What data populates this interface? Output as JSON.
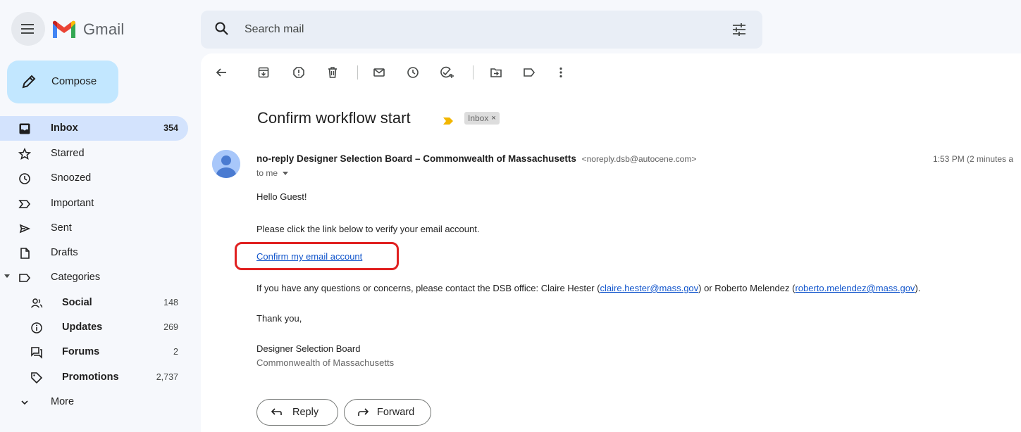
{
  "app": {
    "name": "Gmail"
  },
  "search": {
    "placeholder": "Search mail"
  },
  "compose": {
    "label": "Compose"
  },
  "sidebar": {
    "items": [
      {
        "label": "Inbox",
        "count": "354",
        "icon": "inbox-icon"
      },
      {
        "label": "Starred",
        "count": "",
        "icon": "star-icon"
      },
      {
        "label": "Snoozed",
        "count": "",
        "icon": "clock-icon"
      },
      {
        "label": "Important",
        "count": "",
        "icon": "important-icon"
      },
      {
        "label": "Sent",
        "count": "",
        "icon": "send-icon"
      },
      {
        "label": "Drafts",
        "count": "",
        "icon": "draft-icon"
      },
      {
        "label": "Categories",
        "count": "",
        "icon": "label-icon"
      },
      {
        "label": "Social",
        "count": "148",
        "icon": "people-icon"
      },
      {
        "label": "Updates",
        "count": "269",
        "icon": "info-icon"
      },
      {
        "label": "Forums",
        "count": "2",
        "icon": "forum-icon"
      },
      {
        "label": "Promotions",
        "count": "2,737",
        "icon": "tag-icon"
      },
      {
        "label": "More",
        "count": "",
        "icon": "chevron-down-icon"
      }
    ]
  },
  "email": {
    "subject": "Confirm workflow start",
    "label_chip": "Inbox",
    "label_chip_close": "×",
    "sender_name": "no-reply Designer Selection Board – Commonwealth of Massachusetts",
    "sender_email": "<noreply.dsb@autocene.com>",
    "timestamp": "1:53 PM (2 minutes a",
    "to": "to me",
    "greeting": "Hello Guest!",
    "instruction": "Please click the link below to verify your email account.",
    "confirm_link": "Confirm my email account",
    "contact_prefix": "If you have any questions or concerns, please contact the DSB office: Claire Hester (",
    "contact_email_1": "claire.hester@mass.gov",
    "contact_mid": ") or Roberto Melendez (",
    "contact_email_2": "roberto.melendez@mass.gov",
    "contact_suffix": ").",
    "thanks": "Thank you,",
    "signature_name": "Designer Selection Board",
    "signature_org": "Commonwealth of Massachusetts"
  },
  "actions": {
    "reply": "Reply",
    "forward": "Forward"
  },
  "colors": {
    "compose_bg": "#c2e7ff",
    "active_nav_bg": "#d3e3fd",
    "link": "#1155cc",
    "highlight": "#e02020",
    "importance": "#f2b600"
  }
}
